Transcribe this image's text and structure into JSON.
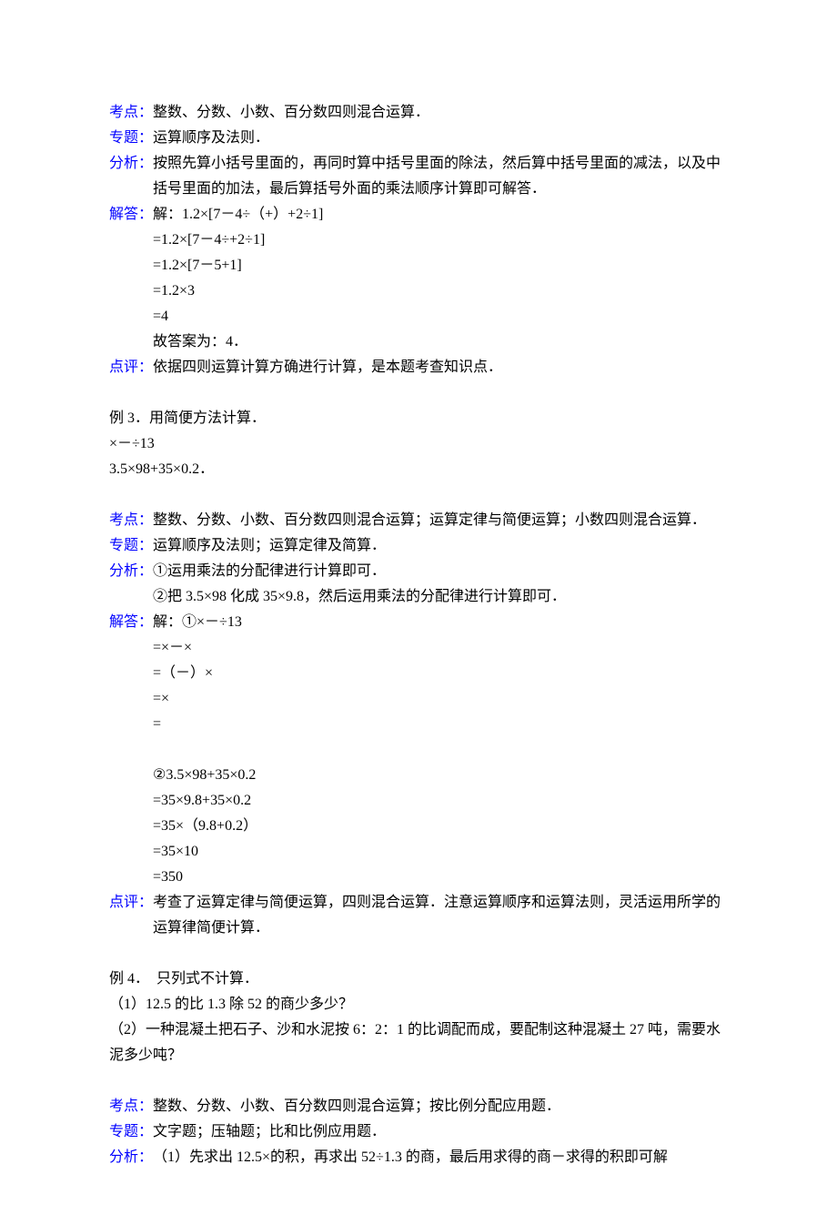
{
  "s1": {
    "kaodian_label": "考点：",
    "kaodian_text": "整数、分数、小数、百分数四则混合运算．",
    "zhuanti_label": "专题：",
    "zhuanti_text": "运算顺序及法则．",
    "fenxi_label": "分析：",
    "fenxi_text": "按照先算小括号里面的，再同时算中括号里面的除法，然后算中括号里面的减法，以及中括号里面的加法，最后算括号外面的乘法顺序计算即可解答．",
    "jieda_label": "解答：",
    "jieda_l1": "解：1.2×[7－4÷（+）+2÷1]",
    "jieda_l2": "=1.2×[7－4÷+2÷1]",
    "jieda_l3": "=1.2×[7－5+1]",
    "jieda_l4": "=1.2×3",
    "jieda_l5": "=4",
    "jieda_l6": "故答案为：4．",
    "dianping_label": "点评：",
    "dianping_text": "依据四则运算计算方确进行计算，是本题考查知识点．"
  },
  "s2": {
    "title": "例 3．用简便方法计算．",
    "p1": "×－÷13",
    "p2": "3.5×98+35×0.2．",
    "kaodian_label": "考点：",
    "kaodian_text": "整数、分数、小数、百分数四则混合运算；运算定律与简便运算；小数四则混合运算．",
    "zhuanti_label": "专题：",
    "zhuanti_text": "运算顺序及法则；运算定律及简算．",
    "fenxi_label": "分析：",
    "fenxi_l1": "①运用乘法的分配律进行计算即可．",
    "fenxi_l2": "②把 3.5×98 化成 35×9.8，然后运用乘法的分配律进行计算即可．",
    "jieda_label": "解答：",
    "jieda_l1": "解：①×－÷13",
    "jieda_l2": "=×－×",
    "jieda_l3": "=（－）×",
    "jieda_l4": "=×",
    "jieda_l5": "=",
    "jieda_l6": "②3.5×98+35×0.2",
    "jieda_l7": "=35×9.8+35×0.2",
    "jieda_l8": "=35×（9.8+0.2）",
    "jieda_l9": "=35×10",
    "jieda_l10": "=350",
    "dianping_label": "点评：",
    "dianping_text": "考查了运算定律与简便运算，四则混合运算．注意运算顺序和运算法则，灵活运用所学的运算律简便计算．"
  },
  "s3": {
    "title": "例 4．　只列式不计算．",
    "q1": "（1）12.5 的比 1.3 除 52 的商少多少？",
    "q2": "（2）一种混凝土把石子、沙和水泥按 6：2：1 的比调配而成，要配制这种混凝土 27 吨，需要水泥多少吨？",
    "kaodian_label": "考点：",
    "kaodian_text": "整数、分数、小数、百分数四则混合运算；按比例分配应用题．",
    "zhuanti_label": "专题：",
    "zhuanti_text": "文字题；压轴题；比和比例应用题．",
    "fenxi_label": "分析：",
    "fenxi_text": "（1）先求出 12.5×的积，再求出 52÷1.3 的商，最后用求得的商－求得的积即可解"
  }
}
